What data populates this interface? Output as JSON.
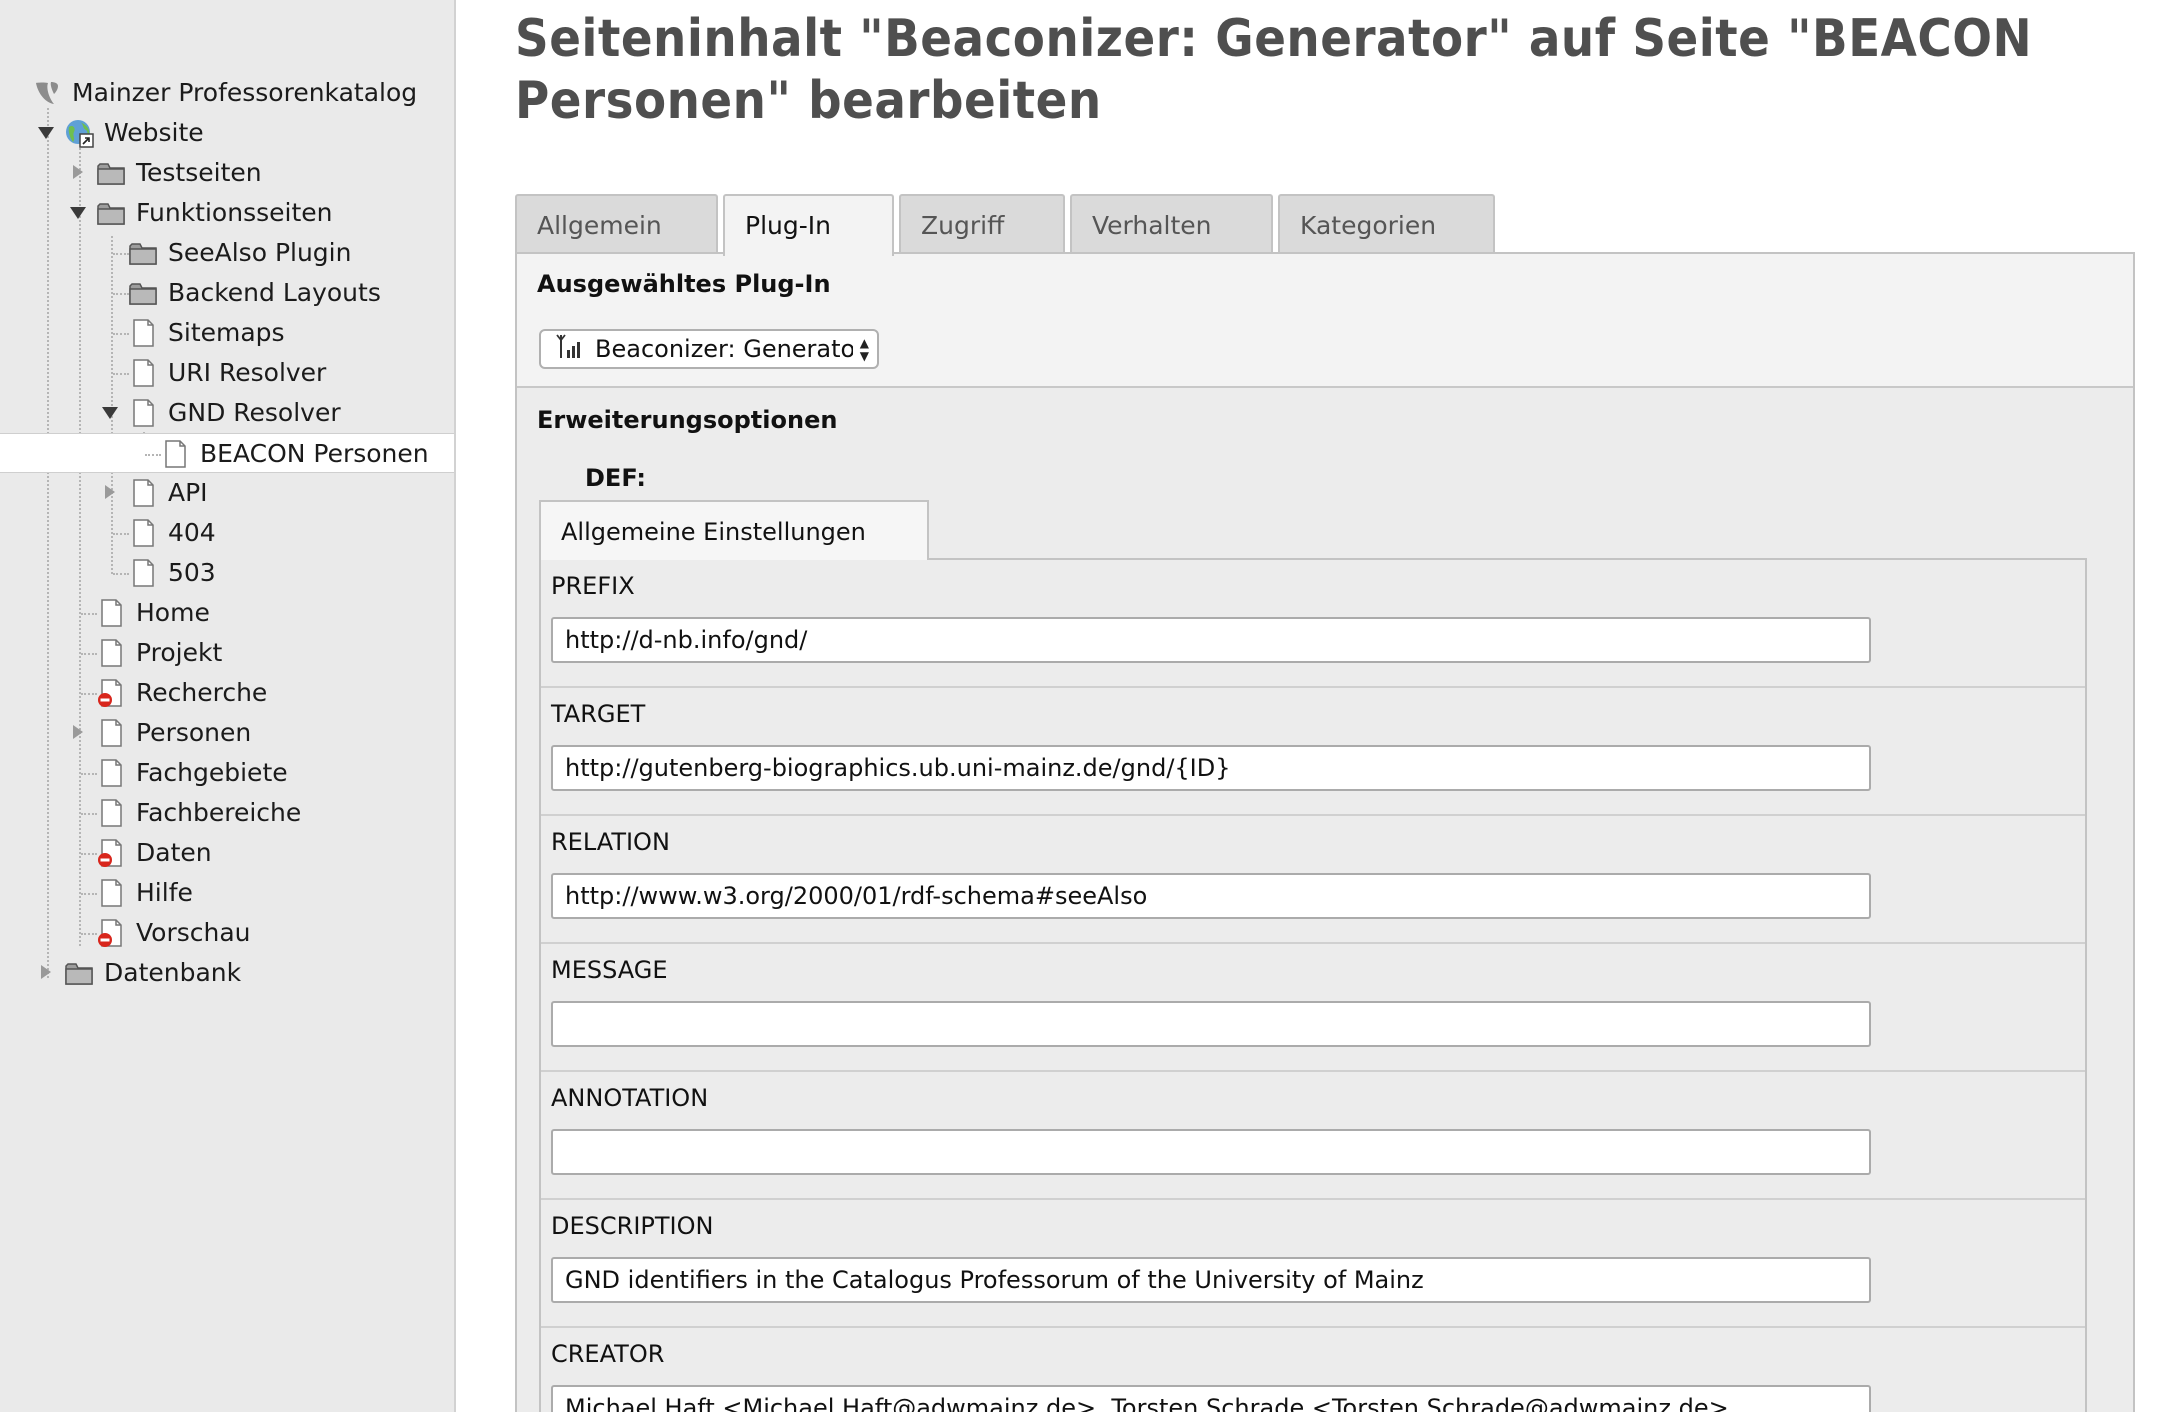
{
  "tree": {
    "root": {
      "label": "Mainzer Professorenkatalog"
    },
    "nodes": [
      {
        "label": "Website",
        "icon": "globe-icon"
      },
      {
        "label": "Testseiten",
        "icon": "folder-icon"
      },
      {
        "label": "Funktionsseiten",
        "icon": "folder-icon"
      },
      {
        "label": "SeeAlso Plugin",
        "icon": "folder-icon"
      },
      {
        "label": "Backend Layouts",
        "icon": "folder-icon"
      },
      {
        "label": "Sitemaps",
        "icon": "page-icon"
      },
      {
        "label": "URI Resolver",
        "icon": "page-icon"
      },
      {
        "label": "GND Resolver",
        "icon": "page-icon"
      },
      {
        "label": "BEACON Personen",
        "icon": "page-icon"
      },
      {
        "label": "API",
        "icon": "page-icon"
      },
      {
        "label": "404",
        "icon": "page-icon"
      },
      {
        "label": "503",
        "icon": "page-icon"
      },
      {
        "label": "Home",
        "icon": "page-icon"
      },
      {
        "label": "Projekt",
        "icon": "page-icon"
      },
      {
        "label": "Recherche",
        "icon": "page-restricted-icon"
      },
      {
        "label": "Personen",
        "icon": "page-icon"
      },
      {
        "label": "Fachgebiete",
        "icon": "page-icon"
      },
      {
        "label": "Fachbereiche",
        "icon": "page-icon"
      },
      {
        "label": "Daten",
        "icon": "page-restricted-icon"
      },
      {
        "label": "Hilfe",
        "icon": "page-icon"
      },
      {
        "label": "Vorschau",
        "icon": "page-restricted-icon"
      },
      {
        "label": "Datenbank",
        "icon": "folder-icon"
      }
    ]
  },
  "page": {
    "title": "Seiteninhalt \"Beaconizer: Generator\" auf Seite \"BEACON Personen\" bearbeiten"
  },
  "tabs": [
    "Allgemein",
    "Plug-In",
    "Zugriff",
    "Verhalten",
    "Kategorien"
  ],
  "plugin": {
    "heading": "Ausgewähltes Plug-In",
    "selected": "Beaconizer: Generator"
  },
  "extension": {
    "heading": "Erweiterungsoptionen",
    "def_label": "DEF:",
    "inner_tab": "Allgemeine Einstellungen",
    "fields": [
      {
        "label": "PREFIX",
        "value": "http://d-nb.info/gnd/"
      },
      {
        "label": "TARGET",
        "value": "http://gutenberg-biographics.ub.uni-mainz.de/gnd/{ID}"
      },
      {
        "label": "RELATION",
        "value": "http://www.w3.org/2000/01/rdf-schema#seeAlso"
      },
      {
        "label": "MESSAGE",
        "value": ""
      },
      {
        "label": "ANNOTATION",
        "value": ""
      },
      {
        "label": "DESCRIPTION",
        "value": "GND identifiers in the Catalogus Professorum of the University of Mainz"
      },
      {
        "label": "CREATOR",
        "value": "Michael Haft <Michael.Haft@adwmainz.de>, Torsten Schrade <Torsten.Schrade@adwmainz.de>"
      }
    ]
  },
  "colors": {
    "sidebar_bg": "#eaeaea",
    "panel_bg": "#f3f3f3",
    "restricted_red": "#d8261c",
    "title_gray": "#4f4f4f"
  }
}
